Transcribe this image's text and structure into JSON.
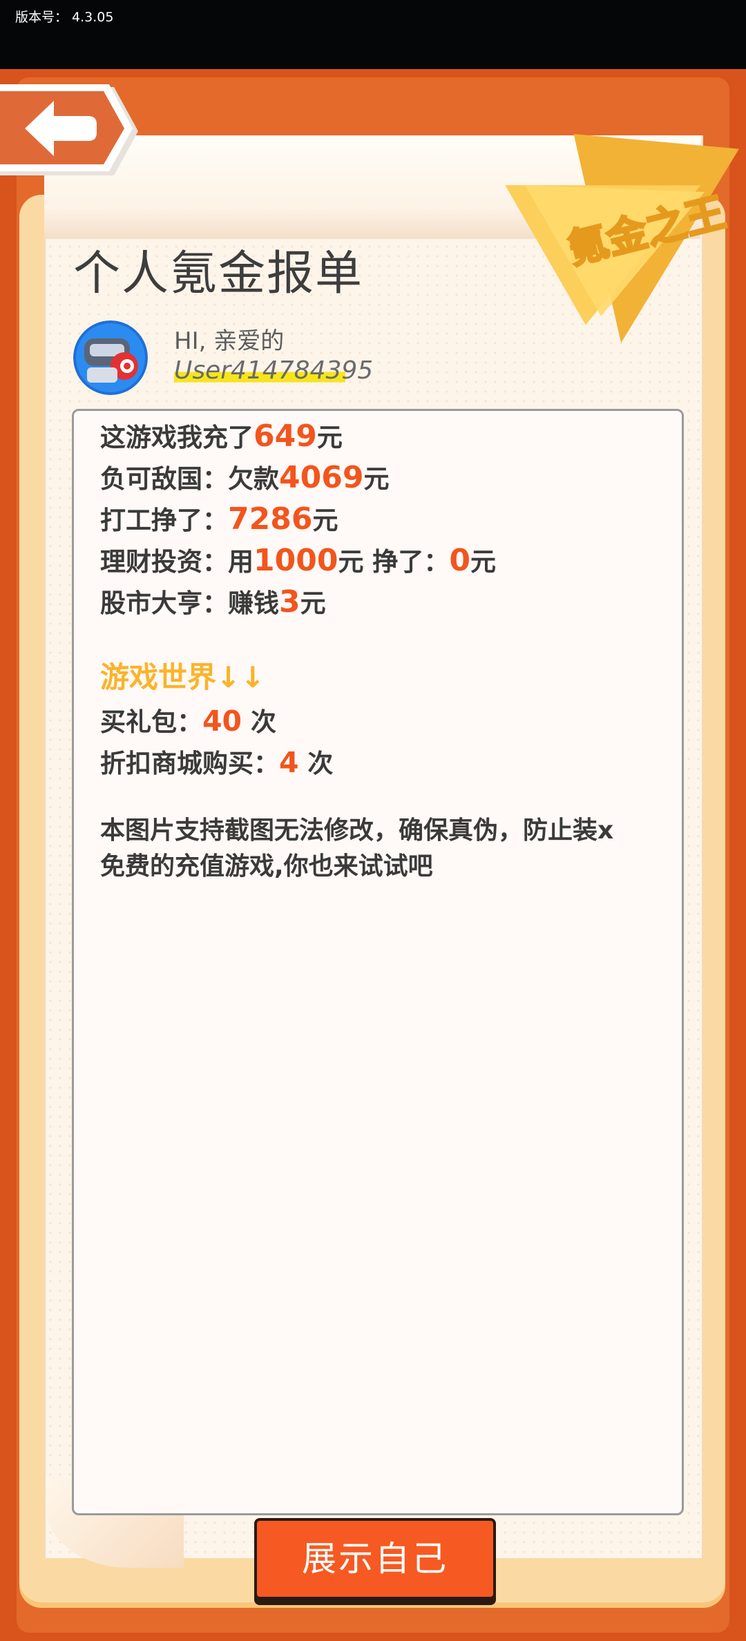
{
  "status_bar": {
    "version_text": "版本号： 4.3.05"
  },
  "header": {
    "title": "个人氪金报单",
    "badge_text": "氪金之王",
    "back_icon": "left-arrow-icon"
  },
  "profile": {
    "greeting": "HI, 亲爱的",
    "username": "User414784395",
    "avatar_icon": "robot-avatar-icon"
  },
  "report": {
    "recharge": {
      "label": "这游戏我充了",
      "value": "649",
      "unit": "元"
    },
    "debt": {
      "label": "负可敌国：欠款",
      "value": "4069",
      "unit": "元"
    },
    "work": {
      "label": "打工挣了：",
      "value": "7286",
      "unit": "元"
    },
    "invest": {
      "label": "理财投资：用",
      "used": "1000",
      "unit1": "元",
      "earned_label": " 挣了：",
      "earned": "0",
      "unit2": "元"
    },
    "stock": {
      "label": "股市大亨：赚钱",
      "value": "3",
      "unit": "元"
    },
    "game_world_heading": "游戏世界↓↓",
    "gift_pack": {
      "label": "买礼包：",
      "value": "40",
      "unit": " 次"
    },
    "discount_shop": {
      "label": "折扣商城购买：",
      "value": "4",
      "unit": " 次"
    },
    "notice_line1": "本图片支持截图无法修改，确保真伪，防止装x",
    "notice_line2": "免费的充值游戏,你也来试试吧"
  },
  "footer": {
    "show_button_label": "展示自己"
  },
  "colors": {
    "background": "#d9531d",
    "accent_number": "#f2551d",
    "section_heading": "#fbb32a",
    "button": "#f65a22"
  }
}
